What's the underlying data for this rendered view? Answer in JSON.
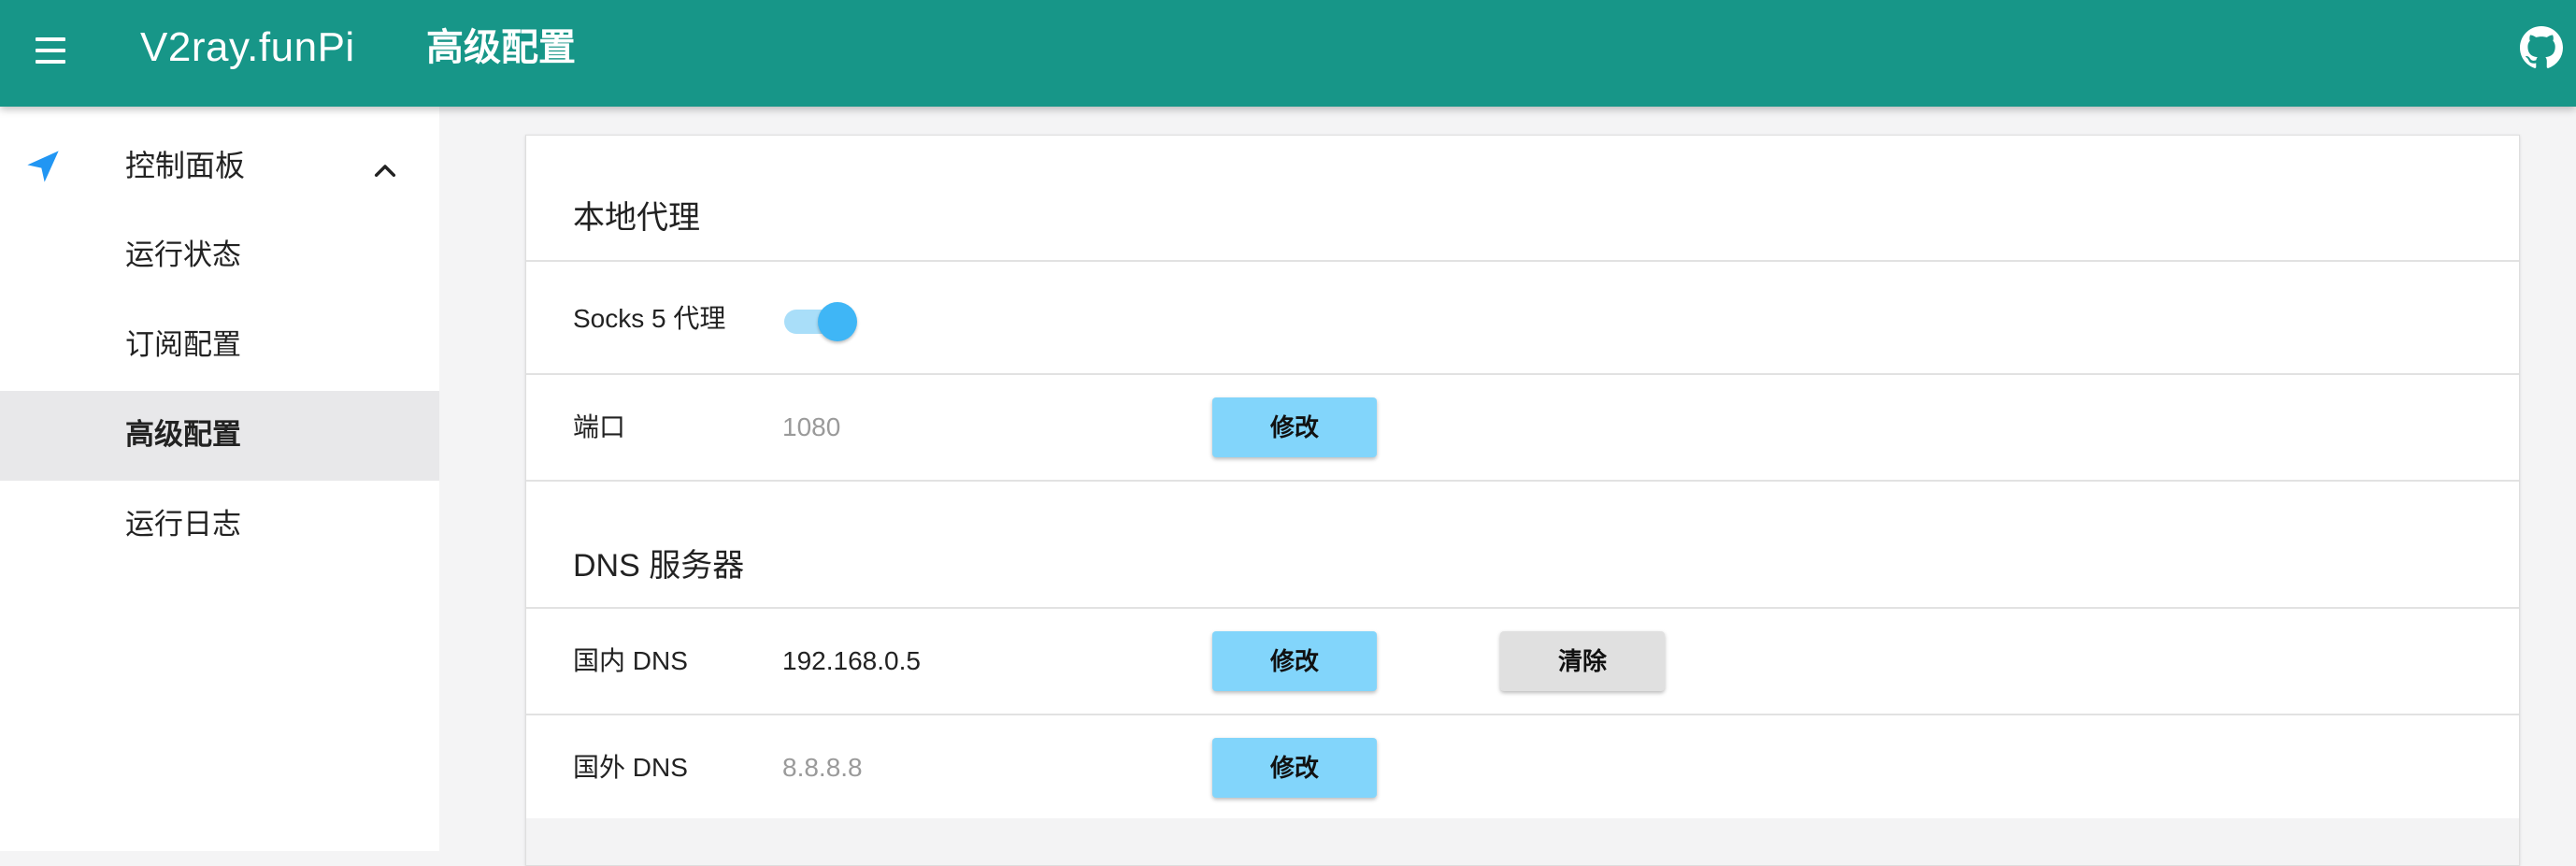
{
  "app": {
    "title": "V2ray.funPi",
    "page_title": "高级配置",
    "menu_icon": "menu-icon",
    "github_icon": "github-icon",
    "colors": {
      "appbar": "#179688",
      "nav_icon": "#2196f3",
      "primary_button": "#82d5fb",
      "secondary_button": "#e0e0e0",
      "toggle_on": "#3fb6f6"
    }
  },
  "sidebar": {
    "group": {
      "label": "控制面板",
      "icon": "send-icon",
      "expand_icon": "chevron-up-icon"
    },
    "items": [
      {
        "label": "运行状态",
        "active": false
      },
      {
        "label": "订阅配置",
        "active": false
      },
      {
        "label": "高级配置",
        "active": true
      },
      {
        "label": "运行日志",
        "active": false
      }
    ]
  },
  "local_proxy": {
    "title": "本地代理",
    "socks": {
      "label": "Socks 5 代理",
      "enabled": true
    },
    "port": {
      "label": "端口",
      "value": "1080",
      "edit_label": "修改"
    }
  },
  "dns": {
    "title": "DNS 服务器",
    "domestic": {
      "label": "国内 DNS",
      "value": "192.168.0.5",
      "edit_label": "修改",
      "clear_label": "清除"
    },
    "foreign": {
      "label": "国外 DNS",
      "value": "8.8.8.8",
      "edit_label": "修改"
    }
  }
}
